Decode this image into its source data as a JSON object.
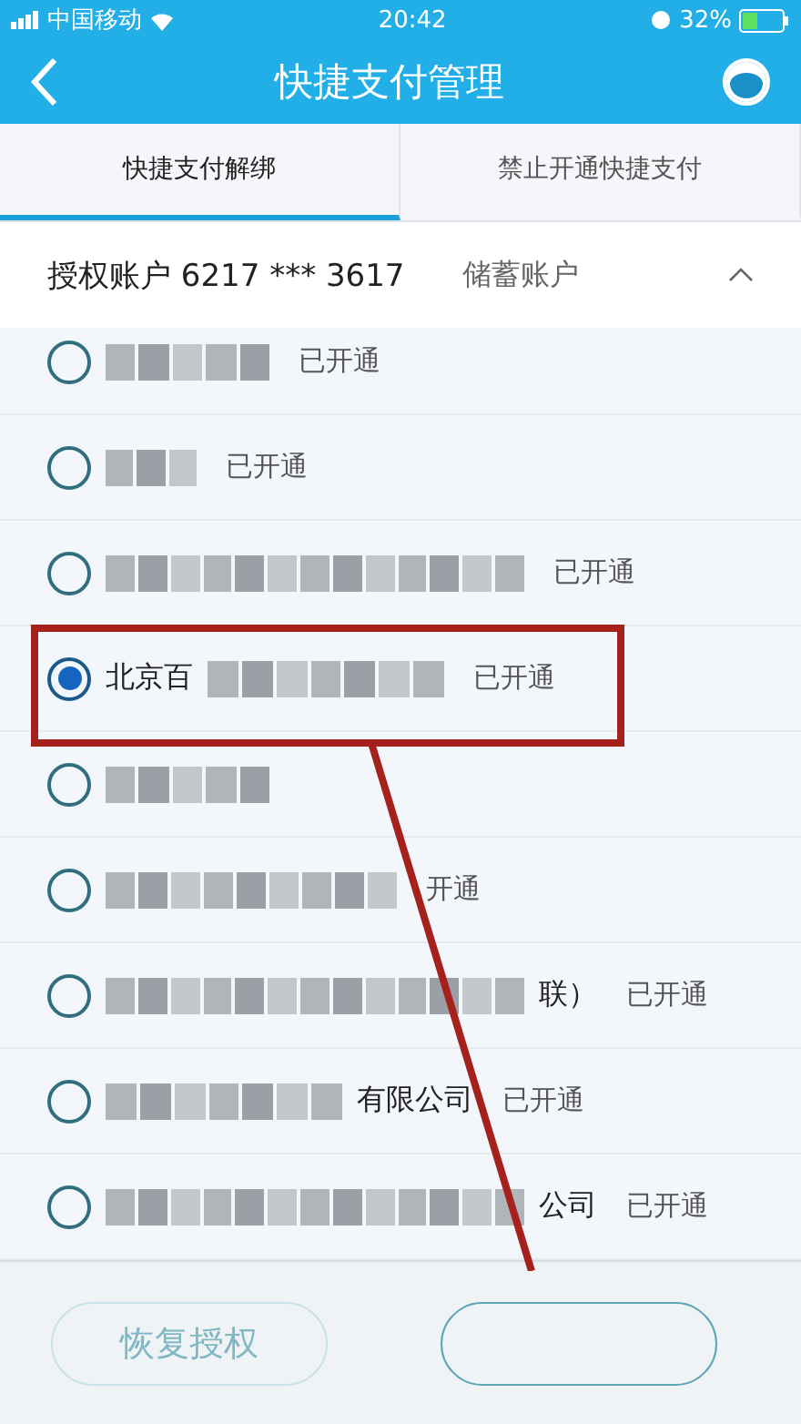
{
  "status_bar": {
    "carrier": "中国移动",
    "time": "20:42",
    "battery": "32%"
  },
  "header": {
    "title": "快捷支付管理"
  },
  "tabs": [
    {
      "label": "快捷支付解绑",
      "selected": true
    },
    {
      "label": "禁止开通快捷支付",
      "selected": false
    }
  ],
  "account": {
    "label": "授权账户 6217 *** 3617",
    "type": "储蓄账户",
    "expanded": true
  },
  "merchants": [
    {
      "redacted": true,
      "status": "已开通",
      "selected": false
    },
    {
      "redacted": true,
      "status": "已开通",
      "selected": false
    },
    {
      "redacted": true,
      "status": "已开通",
      "selected": false
    },
    {
      "prefix": "北京百",
      "redacted": true,
      "status": "已开通",
      "selected": true
    },
    {
      "redacted": true,
      "selected": false
    },
    {
      "redacted": true,
      "status": "开通",
      "selected": false
    },
    {
      "redacted": true,
      "suffix": "联）",
      "status": "已开通",
      "selected": false
    },
    {
      "redacted": true,
      "suffix": "有限公司",
      "status": "已开通",
      "selected": false
    },
    {
      "redacted": true,
      "suffix": "公司",
      "status": "已开通",
      "selected": false
    }
  ],
  "buttons": [
    {
      "label": "恢复授权",
      "disabled": true
    },
    {
      "disabled": false
    }
  ],
  "annotation": {
    "kind": "highlight"
  }
}
